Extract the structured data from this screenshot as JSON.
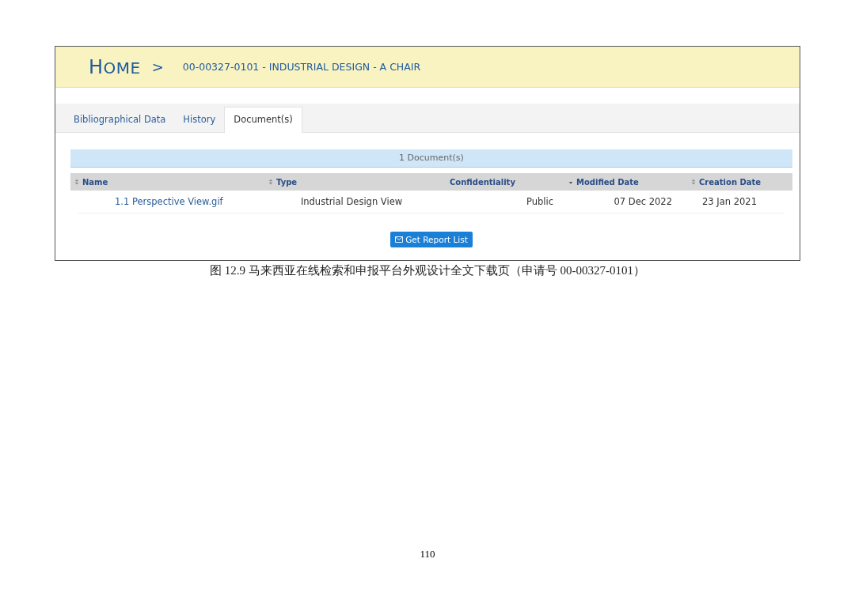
{
  "screenshot": {
    "breadcrumb": {
      "home": "HOME",
      "separator": ">",
      "current": "00-00327-0101 - INDUSTRIAL DESIGN - A CHAIR"
    },
    "tabs": [
      {
        "label": "Bibliographical Data",
        "selected": false
      },
      {
        "label": "History",
        "selected": false
      },
      {
        "label": "Document(s)",
        "selected": true
      }
    ],
    "table": {
      "caption": "1 Document(s)",
      "columns": [
        {
          "label": "Name",
          "kind": "sortable"
        },
        {
          "label": "Type",
          "kind": "sortable"
        },
        {
          "label": "Confidentiality",
          "kind": "plain"
        },
        {
          "label": "Modified Date",
          "kind": "sorted-desc"
        },
        {
          "label": "Creation Date",
          "kind": "sortable"
        }
      ],
      "rows": [
        {
          "cells": [
            {
              "text": "1.1 Perspective View.gif",
              "kind": "link"
            },
            {
              "text": "Industrial Design View",
              "kind": "text"
            },
            {
              "text": "Public",
              "kind": "text"
            },
            {
              "text": "07 Dec 2022",
              "kind": "text"
            },
            {
              "text": "23 Jan 2021",
              "kind": "text"
            }
          ]
        }
      ]
    },
    "button": "Get Report List"
  },
  "caption": "图 12.9  马来西亚在线检索和申报平台外观设计全文下载页（申请号 00-00327-0101）",
  "page_number": "110"
}
